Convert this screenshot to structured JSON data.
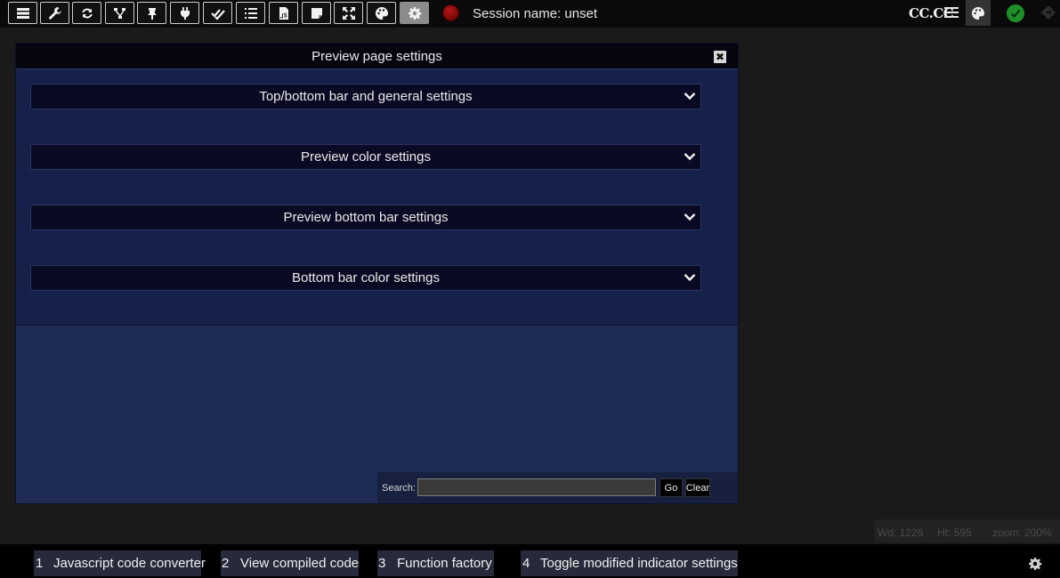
{
  "topbar": {
    "buttons": [
      {
        "icon": "storage-icon"
      },
      {
        "icon": "wrench-icon"
      },
      {
        "icon": "refresh-icon"
      },
      {
        "icon": "sitemap-icon"
      },
      {
        "icon": "pin-icon"
      },
      {
        "icon": "plug-icon"
      },
      {
        "icon": "double-check-icon"
      },
      {
        "icon": "list-icon"
      },
      {
        "icon": "js-file-icon"
      },
      {
        "icon": "note-icon"
      },
      {
        "icon": "expand-icon"
      },
      {
        "icon": "palette-icon"
      },
      {
        "icon": "gear-icon",
        "active": true
      }
    ],
    "session_label": "Session name: unset",
    "brand": "CC.CC",
    "status_color": "#1f8f2a",
    "record_color": "#8b0000"
  },
  "dialog": {
    "title": "Preview page settings",
    "close_symbol": "✖",
    "sections": [
      {
        "label": "Top/bottom bar and general settings"
      },
      {
        "label": "Preview color settings"
      },
      {
        "label": "Preview bottom bar settings"
      },
      {
        "label": "Bottom bar color settings"
      }
    ],
    "search": {
      "label": "Search:",
      "value": "",
      "go_label": "Go",
      "clear_label": "Clear"
    }
  },
  "status": {
    "width": "Wd: 1226",
    "height": "Ht: 595",
    "zoom": "zoom: 200%"
  },
  "bottombar": {
    "items": [
      {
        "num": "1",
        "label": "Javascript code converter"
      },
      {
        "num": "2",
        "label": "View compiled code"
      },
      {
        "num": "3",
        "label": "Function factory"
      },
      {
        "num": "4",
        "label": "Toggle modified indicator settings"
      }
    ]
  }
}
